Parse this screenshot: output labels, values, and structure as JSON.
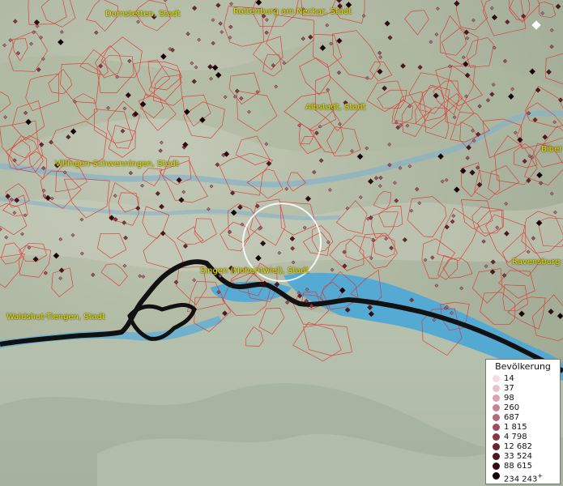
{
  "map": {
    "cities": [
      {
        "id": "dornstetten",
        "label": "Dornstetten, Stadt"
      },
      {
        "id": "rottenburg",
        "label": "Rottenburg am Neckar, Stadt"
      },
      {
        "id": "albstadt",
        "label": "Albstadt, Stadt"
      },
      {
        "id": "biberach",
        "label": "Biber"
      },
      {
        "id": "villingen",
        "label": "Villingen-Schwenningen, Stadt"
      },
      {
        "id": "singen",
        "label": "Singen (Hohentwiel), Stadt"
      },
      {
        "id": "ravensburg",
        "label": "Ravensburg"
      },
      {
        "id": "waldshut",
        "label": "Waldshut-Tiengen, Stadt"
      }
    ],
    "colors": {
      "border_lines": "#e03030",
      "country_border": "#111111",
      "water": "#4aa8d8",
      "terrain_light": "#c9cfbf",
      "terrain_dark": "#9aa592",
      "label_text": "#e8e000"
    }
  },
  "legend": {
    "title": "Bevölkerung",
    "items": [
      {
        "label": "14",
        "color": "#f2dce4"
      },
      {
        "label": "37",
        "color": "#e7c2cd"
      },
      {
        "label": "98",
        "color": "#d8a2b0"
      },
      {
        "label": "260",
        "color": "#c78594"
      },
      {
        "label": "687",
        "color": "#b56a79"
      },
      {
        "label": "1 815",
        "color": "#9e4e5c"
      },
      {
        "label": "4 798",
        "color": "#863843"
      },
      {
        "label": "12 682",
        "color": "#6b2530"
      },
      {
        "label": "33 524",
        "color": "#4f161e"
      },
      {
        "label": "88 615",
        "color": "#330b10"
      },
      {
        "label": "234 243",
        "color": "#160405",
        "suffix": "+"
      }
    ]
  }
}
